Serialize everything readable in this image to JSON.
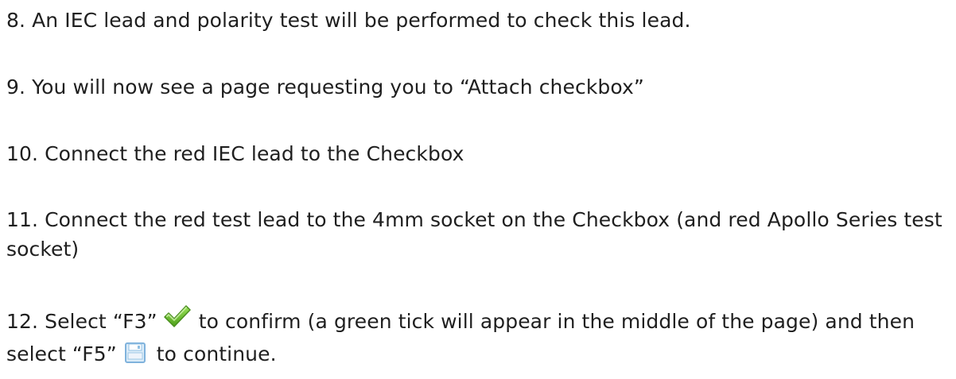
{
  "steps": [
    {
      "text": "8. An IEC lead and polarity test will be performed to check this lead."
    },
    {
      "text": "9. You will now see a page requesting you to “Attach checkbox”"
    },
    {
      "text": "10. Connect the red IEC lead to the Checkbox"
    },
    {
      "text": "11. Connect the red test lead to the 4mm socket on the Checkbox (and red Apollo Series test socket)"
    },
    {
      "part1": "12. Select “F3”",
      "icon1": "green-tick-icon",
      "part2": "to confirm (a green tick will appear in the middle of the page) and then select “F5”",
      "icon2": "save-icon",
      "part3": "to continue."
    }
  ],
  "colors": {
    "text": "#1f1f1f",
    "tick_green": "#6cc225",
    "save_blue": "#7fb2dc"
  }
}
